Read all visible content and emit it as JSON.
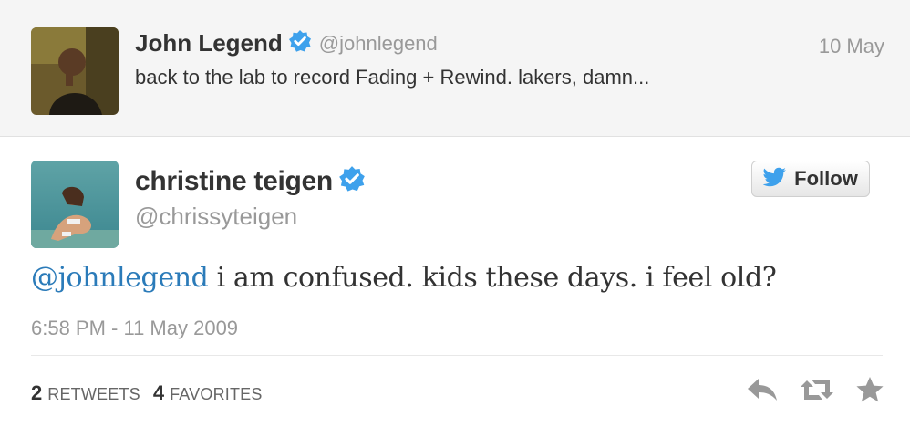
{
  "parent_tweet": {
    "name": "John Legend",
    "handle": "@johnlegend",
    "date": "10 May",
    "text": "back to the lab to record Fading + Rewind.  lakers, damn..."
  },
  "main_tweet": {
    "name": "christine teigen",
    "handle": "@chrissyteigen",
    "follow_label": "Follow",
    "mention": "@johnlegend",
    "text": " i am confused. kids these days. i feel old?",
    "timestamp": "6:58 PM - 11 May 2009",
    "retweets_count": "2",
    "retweets_label": "RETWEETS",
    "favorites_count": "4",
    "favorites_label": "FAVORITES"
  },
  "icons": {
    "verified": "verified-badge-icon",
    "twitter_bird": "twitter-bird-icon",
    "reply": "reply-icon",
    "retweet": "retweet-icon",
    "favorite": "star-icon"
  },
  "colors": {
    "link": "#2b7bb9",
    "verified": "#3ea1ec",
    "muted": "#999999",
    "action_icon": "#999999"
  }
}
